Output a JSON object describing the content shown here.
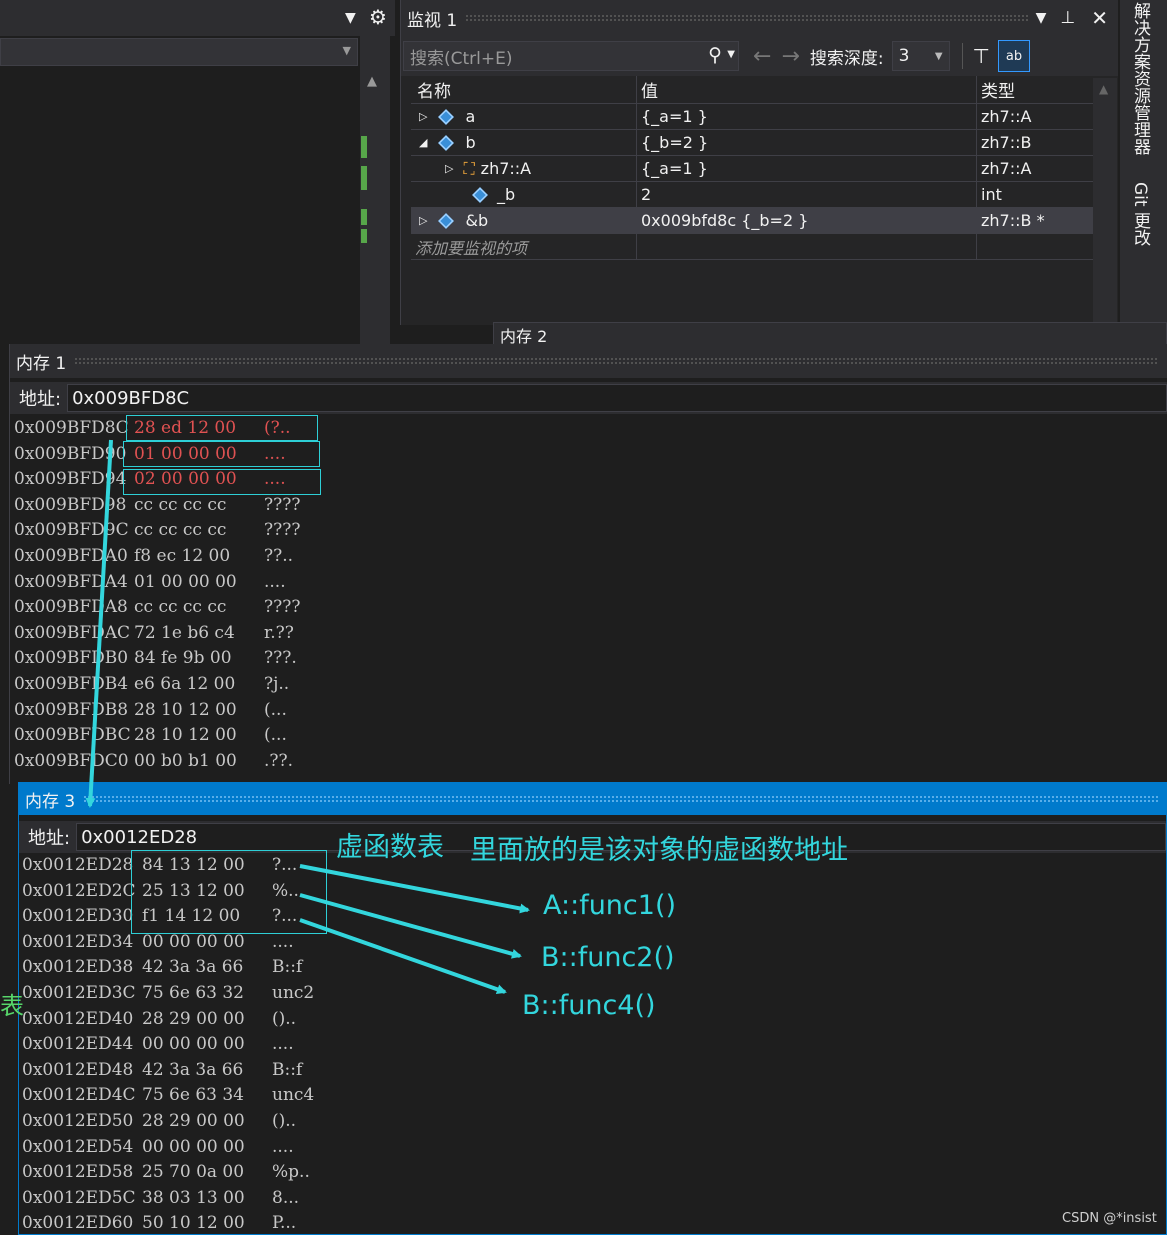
{
  "editor": {
    "settings_icon": "gear-icon"
  },
  "watch": {
    "title": "监视 1",
    "search_placeholder": "搜索(Ctrl+E)",
    "search_depth_label": "搜索深度:",
    "search_depth_value": "3",
    "columns": {
      "name": "名称",
      "value": "值",
      "type": "类型"
    },
    "rows": [
      {
        "name": "a",
        "value": "{_a=1 }",
        "type": "zh7::A"
      },
      {
        "name": "b",
        "value": "{_b=2 }",
        "type": "zh7::B"
      },
      {
        "name": "zh7::A",
        "value": "{_a=1 }",
        "type": "zh7::A"
      },
      {
        "name": "_b",
        "value": "2",
        "type": "int"
      },
      {
        "name": "&b",
        "value": "0x009bfd8c {_b=2 }",
        "type": "zh7::B *"
      }
    ],
    "add_placeholder": "添加要监视的项"
  },
  "side_tabs": {
    "solution_explorer": "解决方案资源管理器",
    "git_changes": "Git 更改"
  },
  "memory2": {
    "title": "内存 2"
  },
  "memory1": {
    "title": "内存 1",
    "address_label": "地址:",
    "address_value": "0x009BFD8C",
    "rows": [
      {
        "addr": "0x009BFD8C",
        "bytes": "28 ed 12 00",
        "ascii": "(?.."
      },
      {
        "addr": "0x009BFD90",
        "bytes": "01 00 00 00",
        "ascii": "...."
      },
      {
        "addr": "0x009BFD94",
        "bytes": "02 00 00 00",
        "ascii": "...."
      },
      {
        "addr": "0x009BFD98",
        "bytes": "cc cc cc cc",
        "ascii": "????"
      },
      {
        "addr": "0x009BFD9C",
        "bytes": "cc cc cc cc",
        "ascii": "????"
      },
      {
        "addr": "0x009BFDA0",
        "bytes": "f8 ec 12 00",
        "ascii": "??.."
      },
      {
        "addr": "0x009BFDA4",
        "bytes": "01 00 00 00",
        "ascii": "...."
      },
      {
        "addr": "0x009BFDA8",
        "bytes": "cc cc cc cc",
        "ascii": "????"
      },
      {
        "addr": "0x009BFDAC",
        "bytes": "72 1e b6 c4",
        "ascii": "r.??"
      },
      {
        "addr": "0x009BFDB0",
        "bytes": "84 fe 9b 00",
        "ascii": "???."
      },
      {
        "addr": "0x009BFDB4",
        "bytes": "e6 6a 12 00",
        "ascii": "?j.."
      },
      {
        "addr": "0x009BFDB8",
        "bytes": "28 10 12 00",
        "ascii": "(..."
      },
      {
        "addr": "0x009BFDBC",
        "bytes": "28 10 12 00",
        "ascii": "(..."
      },
      {
        "addr": "0x009BFDC0",
        "bytes": "00 b0 b1 00",
        "ascii": ".??."
      }
    ]
  },
  "memory3": {
    "title": "内存 3",
    "address_label": "地址:",
    "address_value": "0x0012ED28",
    "rows": [
      {
        "addr": "0x0012ED28",
        "bytes": "84 13 12 00",
        "ascii": "?..."
      },
      {
        "addr": "0x0012ED2C",
        "bytes": "25 13 12 00",
        "ascii": "%..."
      },
      {
        "addr": "0x0012ED30",
        "bytes": "f1 14 12 00",
        "ascii": "?..."
      },
      {
        "addr": "0x0012ED34",
        "bytes": "00 00 00 00",
        "ascii": "...."
      },
      {
        "addr": "0x0012ED38",
        "bytes": "42 3a 3a 66",
        "ascii": "B::f"
      },
      {
        "addr": "0x0012ED3C",
        "bytes": "75 6e 63 32",
        "ascii": "unc2"
      },
      {
        "addr": "0x0012ED40",
        "bytes": "28 29 00 00",
        "ascii": "().."
      },
      {
        "addr": "0x0012ED44",
        "bytes": "00 00 00 00",
        "ascii": "...."
      },
      {
        "addr": "0x0012ED48",
        "bytes": "42 3a 3a 66",
        "ascii": "B::f"
      },
      {
        "addr": "0x0012ED4C",
        "bytes": "75 6e 63 34",
        "ascii": "unc4"
      },
      {
        "addr": "0x0012ED50",
        "bytes": "28 29 00 00",
        "ascii": "().."
      },
      {
        "addr": "0x0012ED54",
        "bytes": "00 00 00 00",
        "ascii": "...."
      },
      {
        "addr": "0x0012ED58",
        "bytes": "25 70 0a 00",
        "ascii": "%p.."
      },
      {
        "addr": "0x0012ED5C",
        "bytes": "38 03 13 00",
        "ascii": "8..."
      },
      {
        "addr": "0x0012ED60",
        "bytes": "50 10 12 00",
        "ascii": "P..."
      }
    ]
  },
  "annotations": {
    "vtable": "虚函数表",
    "vtable_desc": "里面放的是该对象的虚函数地址",
    "func1": "A::func1()",
    "func2": "B::func2()",
    "func4": "B::func4()"
  },
  "edge_glyph": "表",
  "watermark": "CSDN @*insist",
  "colors": {
    "accent": "#007acc",
    "annotation": "#33d6dd",
    "changed_value": "#e05252"
  }
}
